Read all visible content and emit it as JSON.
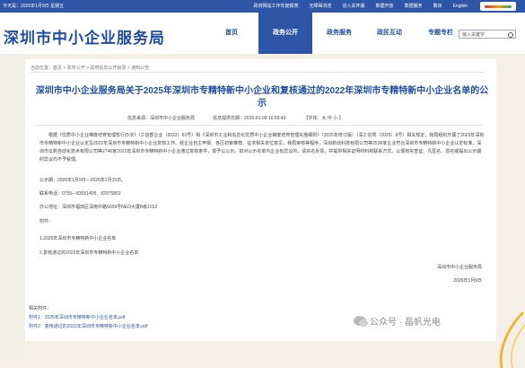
{
  "topbar": {
    "date": "今天是：2026年1月9日 星期五",
    "links": [
      "政府网站工作年度报表",
      "无障碍浏览",
      "进入关怀版",
      "数据开放",
      "数据服务",
      "繁体",
      "English"
    ]
  },
  "header": {
    "title": "深圳市中小企业服务局",
    "nav": [
      "首页",
      "政务公开",
      "政务服务",
      "政民互动",
      "专题专栏"
    ],
    "search_placeholder": "输入关键字"
  },
  "breadcrumb": "当前位置：首页 > 政务公开 > 政府信息公开目录 > 通知公告",
  "article": {
    "title": "深圳市中小企业服务局关于2025年深圳市专精特新中小企业和复核通过的2022年深圳市专精特新中小企业名单的公示",
    "source": "信息来源：深圳市中小企业服务局",
    "date": "信息提供日期：2026-01-09 16:58:43",
    "font": "【字体：大 中 小 】",
    "para": "根据《优质中小企业梯度培育管理暂行办法》（工信部企业〔2022〕63号）和《深圳市工业和信息化优质中小企业梯度培育管理实施细则》（2025年修订版）（深工信规〔2025〕8号）相关规定，我局组织开展了2025年深圳市专精特新中小企业认定及2022年深圳市专精特新中小企业复核工作。经企业自主申报、各区初审推荐、征求相关单位意见，我局审核等程序，深圳新动科技有限公司等2536家企业符合深圳市专精特新中小企业认定标准，深圳市云帆自动化技术有限公司等2746家2022年深圳市专精特新中小企业通过复核条件，现予以公示。如对公示名单内企业有异议的，请实名反馈，并提供相关证明材料和联系方式，以便核实查证。凡匿名、冒名或提出公示期的异议均不予受理。",
    "period": "公示期：2026年1月9日—2026年1月15日。",
    "phone": "联系电话：0755—83051495、82975802",
    "address": "办公地址：深圳市福田区深南中路6009号NEO大厦B栋1012",
    "attach_label": "附件：",
    "attach1": "1.2025年深圳市专精特新中小企业名单",
    "attach2": "2.复核通过的2022年深圳市专精特新中小企业名单",
    "signature": "深圳市中小企业服务局",
    "sign_date": "2026年1月9日"
  },
  "attachments": {
    "title": "相关附件：",
    "items": [
      "附件1：2025年深圳市专精特新中小企业名单.pdf",
      "附件2：复核通过的2022年深圳市专精特新中小企业名单.pdf"
    ]
  },
  "watermark": "公众号 · 晶帆光电",
  "colors": {
    "primary": "#2f55a6",
    "title": "#1f4ea0",
    "link": "#2f55a6"
  }
}
